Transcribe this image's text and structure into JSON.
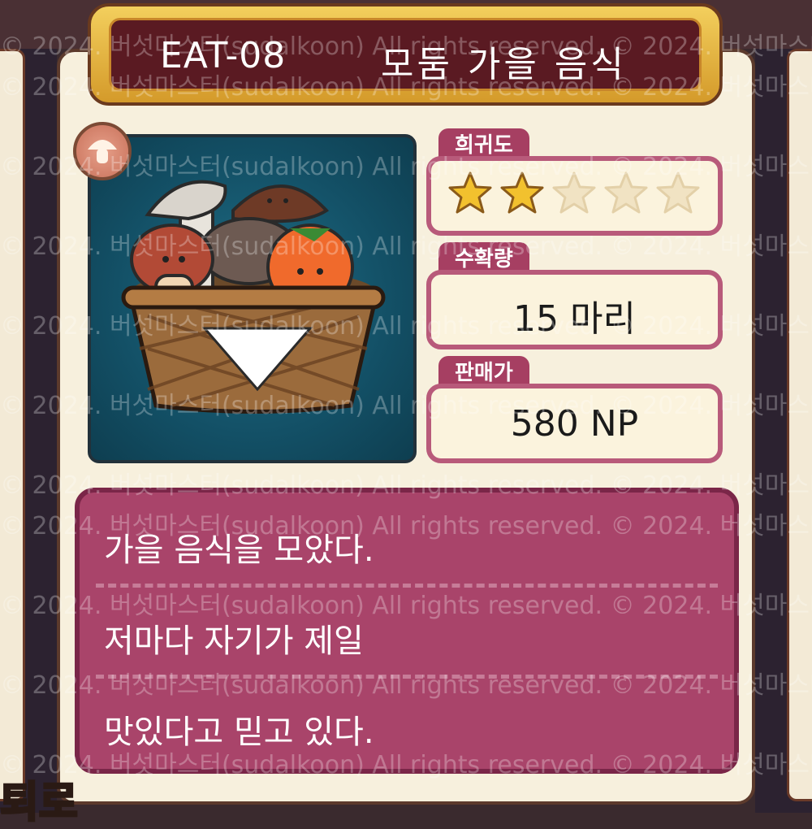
{
  "item": {
    "code": "EAT-08",
    "name": "모둠 가을 음식"
  },
  "stats": {
    "rarity_label": "희귀도",
    "rarity_filled": 2,
    "rarity_max": 5,
    "harvest_label": "수확량",
    "harvest_value": "15 마리",
    "price_label": "판매가",
    "price_value": "580 NP"
  },
  "description": {
    "lines": [
      "가을 음식을 모았다.",
      "저마다 자기가 제일",
      "맛있다고 믿고 있다."
    ]
  },
  "watermark": "© 2024. 버섯마스터(sudalkoon) All rights reserved.",
  "bottom_logo": "퇴로",
  "colors": {
    "accent": "#a63f62",
    "star_filled": "#f2c12e",
    "star_empty": "#f1e3c3"
  }
}
